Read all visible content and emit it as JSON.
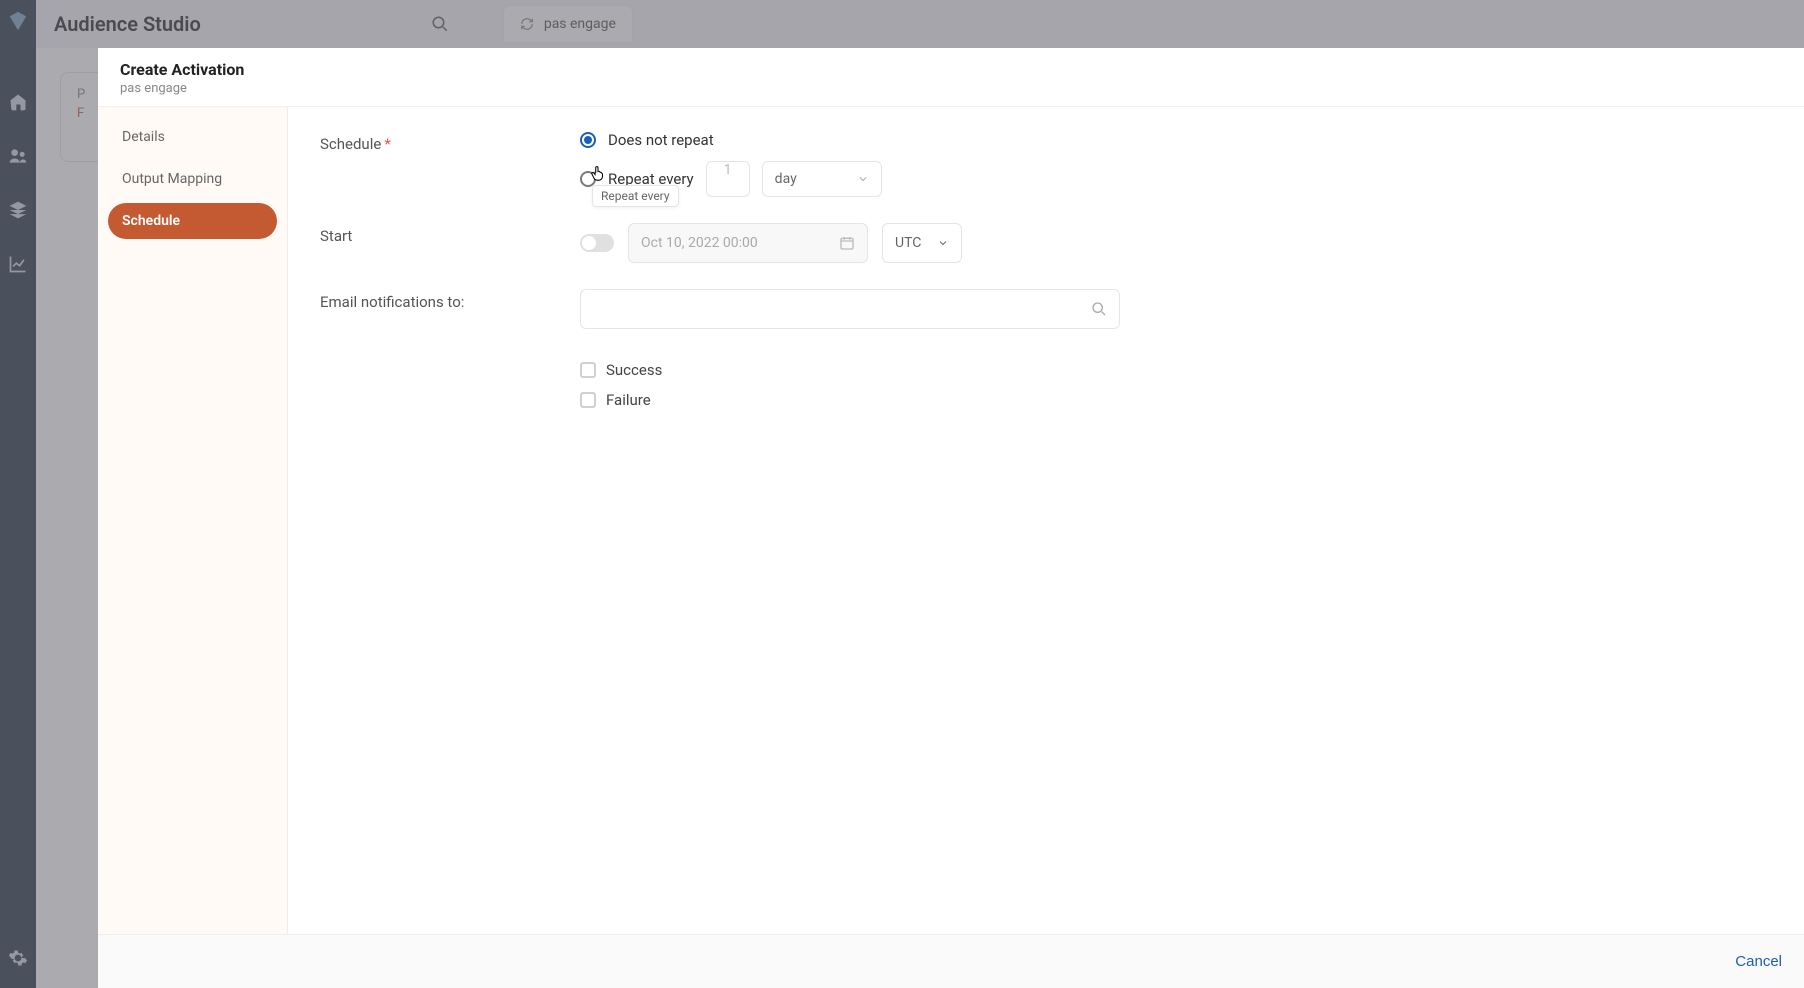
{
  "background": {
    "app_title": "Audience Studio",
    "tab_label": "pas engage",
    "card": {
      "line1": "P",
      "line2": "F"
    }
  },
  "modal": {
    "title": "Create Activation",
    "subtitle": "pas engage",
    "steps": [
      "Details",
      "Output Mapping",
      "Schedule"
    ],
    "active_step": "Schedule",
    "labels": {
      "schedule": "Schedule",
      "start": "Start",
      "email_to": "Email notifications to:"
    },
    "schedule": {
      "does_not_repeat": "Does not repeat",
      "repeat_every": "Repeat every",
      "repeat_value": "1",
      "repeat_unit": "day",
      "tooltip": "Repeat every"
    },
    "start": {
      "date_value": "Oct 10, 2022 00:00",
      "timezone": "UTC"
    },
    "notify": {
      "success": "Success",
      "failure": "Failure"
    },
    "footer": {
      "cancel": "Cancel"
    }
  }
}
